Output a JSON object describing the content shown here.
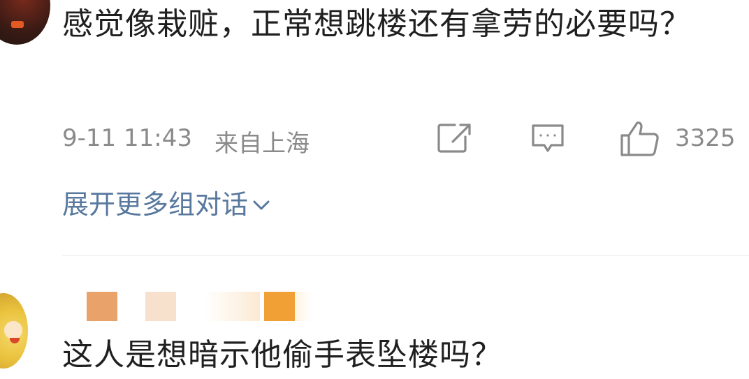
{
  "comment1": {
    "text": "感觉像栽赃，正常想跳楼还有拿劳的必要吗？",
    "date": "9-11 11:43",
    "location": "来自上海",
    "likes": "3325",
    "expand_label": "展开更多组对话",
    "icons": {
      "share": "share-icon",
      "reply": "comment-icon",
      "like": "thumbs-up-icon",
      "expand": "chevron-down-icon"
    }
  },
  "comment2": {
    "text": "这人是想暗示他偷手表坠楼吗？",
    "username_mask_colors": [
      "#e9a26a",
      "#f7e1cc",
      "#fbe9d2",
      "#f0a034"
    ]
  },
  "colors": {
    "text": "#1f1f1f",
    "meta": "#8a8a8a",
    "link": "#58789e",
    "divider": "#ececec"
  }
}
